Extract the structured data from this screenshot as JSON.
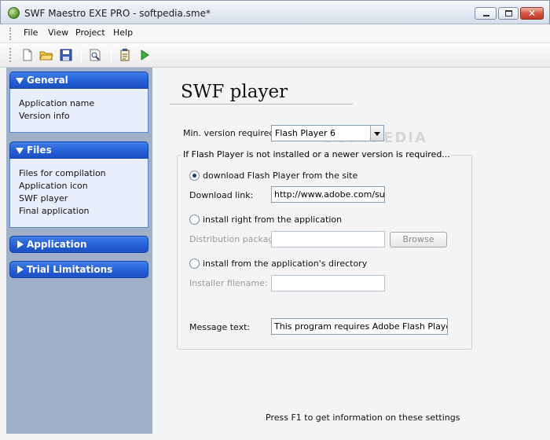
{
  "window": {
    "title": "SWF Maestro EXE PRO - softpedia.sme*"
  },
  "menu": {
    "items": [
      "File",
      "View",
      "Project",
      "Help"
    ]
  },
  "toolbar": {
    "buttons": [
      "new-icon",
      "open-folder-icon",
      "save-icon",
      "print-preview-icon",
      "project-icon",
      "run-icon"
    ]
  },
  "sidebar": {
    "panels": [
      {
        "title": "General",
        "expanded": true,
        "items": [
          "Application name",
          "Version info"
        ]
      },
      {
        "title": "Files",
        "expanded": true,
        "items": [
          "Files for compilation",
          "Application icon",
          "SWF player",
          "Final application"
        ]
      },
      {
        "title": "Application",
        "expanded": false,
        "items": []
      },
      {
        "title": "Trial Limitations",
        "expanded": false,
        "items": []
      }
    ]
  },
  "main": {
    "heading": "SWF player",
    "min_version_label": "Min. version required:",
    "min_version_value": "Flash Player 6",
    "group_caption": "If Flash Player is not installed or a newer version is required...",
    "option_download": "download Flash Player from the site",
    "download_link_label": "Download link:",
    "download_link_value": "http://www.adobe.com/supp",
    "option_install_app": "install right from the application",
    "distribution_label": "Distribution package:",
    "distribution_value": "",
    "browse_label": "Browse",
    "option_install_dir": "install from the application's directory",
    "installer_label": "Installer filename:",
    "installer_value": "",
    "message_label": "Message text:",
    "message_value": "This program requires Adobe Flash Player Activ",
    "footer": "Press F1 to get information on these settings",
    "watermark": "SOFTPEDIA"
  },
  "colors": {
    "panel_header": "#245dd4",
    "sidebar_bg": "#9fb0c8",
    "panel_body": "#e9eefb"
  }
}
